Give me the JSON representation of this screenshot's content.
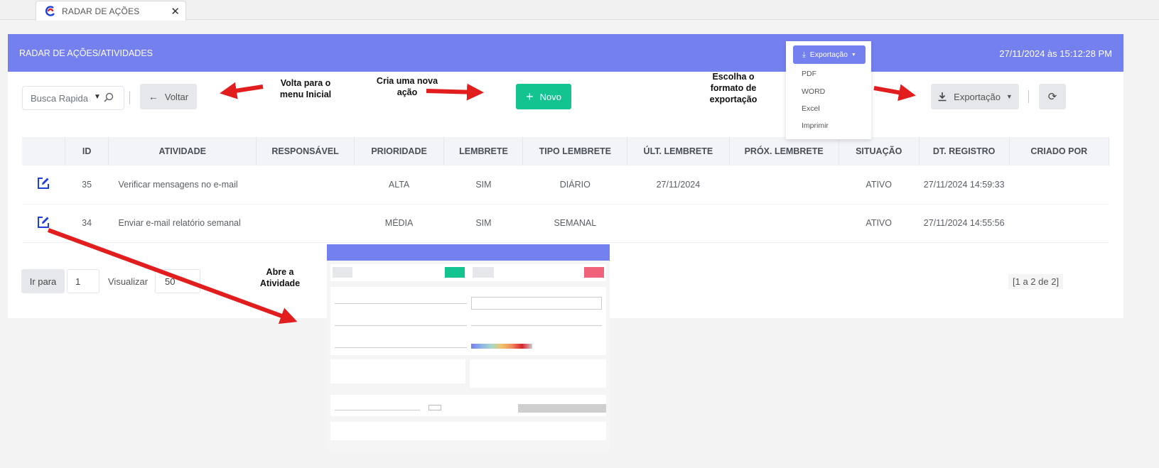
{
  "tab": {
    "title": "RADAR DE AÇÕES",
    "close_symbol": "✕"
  },
  "header": {
    "title": "RADAR DE AÇÕES/ATIVIDADES",
    "datetime": "27/11/2024 às 15:12:28 PM"
  },
  "toolbar": {
    "search_placeholder": "Busca Rapida",
    "back_label": "Voltar",
    "new_label": "Novo",
    "export_label": "Exportação"
  },
  "annotations": {
    "back": "Volta para o menu Inicial",
    "new": "Cria uma nova ação",
    "export": "Escolha o formato de exportação",
    "open": "Abre a Atividade"
  },
  "export_menu": {
    "button": "Exportação",
    "items": [
      "PDF",
      "WORD",
      "Excel",
      "Imprimir"
    ]
  },
  "table": {
    "columns": [
      "",
      "ID",
      "ATIVIDADE",
      "RESPONSÁVEL",
      "PRIORIDADE",
      "LEMBRETE",
      "TIPO LEMBRETE",
      "ÚLT. LEMBRETE",
      "PRÓX. LEMBRETE",
      "SITUAÇÃO",
      "DT. REGISTRO",
      "CRIADO POR"
    ],
    "rows": [
      {
        "id": "35",
        "atividade": "Verificar mensagens no e-mail",
        "responsavel": "",
        "prioridade": "ALTA",
        "lembrete": "SIM",
        "tipo": "DIÁRIO",
        "ult": "27/11/2024",
        "prox": "",
        "situacao": "ATIVO",
        "registro": "27/11/2024 14:59:33",
        "criado": ""
      },
      {
        "id": "34",
        "atividade": "Enviar e-mail relatório semanal",
        "responsavel": "",
        "prioridade": "MÉDIA",
        "lembrete": "SIM",
        "tipo": "SEMANAL",
        "ult": "",
        "prox": "",
        "situacao": "ATIVO",
        "registro": "27/11/2024 14:55:56",
        "criado": ""
      }
    ]
  },
  "pagination": {
    "goto_label": "Ir para",
    "page": "1",
    "view_label": "Visualizar",
    "per_page": "50",
    "range": "[1 a 2 de 2]"
  },
  "colors": {
    "header": "#7580ef",
    "green": "#14c490",
    "annotation_arrow": "#e11d1d",
    "edit_icon": "#1e3fd8"
  }
}
